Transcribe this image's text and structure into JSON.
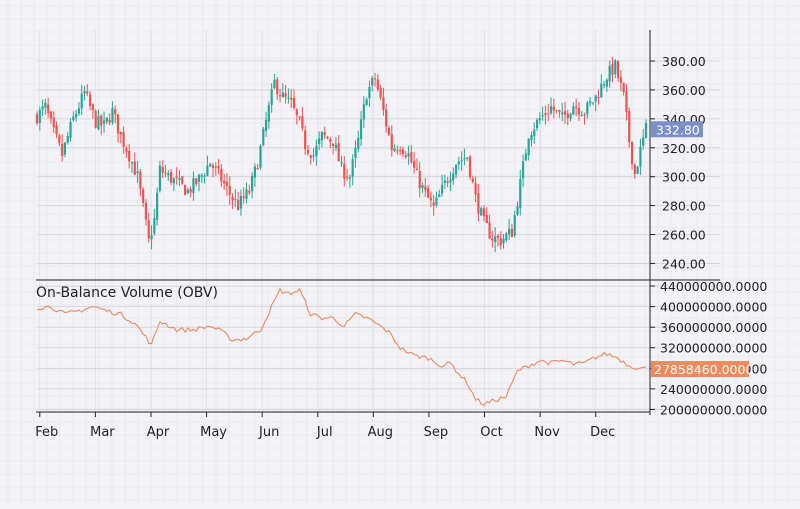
{
  "chart_data": [
    {
      "type": "candlestick",
      "title": "",
      "y_axis_side": "right",
      "ylim": [
        232,
        398
      ],
      "y_ticks": [
        "240.00",
        "260.00",
        "280.00",
        "300.00",
        "320.00",
        "340.00",
        "360.00",
        "380.00"
      ],
      "last_price_label": "332.80",
      "last_price": 332.8,
      "x_ticks": [
        "Feb",
        "Mar",
        "Apr",
        "May",
        "Jun",
        "Jul",
        "Aug",
        "Sep",
        "Oct",
        "Nov",
        "Dec"
      ],
      "grid": true,
      "colors": {
        "up": "#26a69a",
        "down": "#ef5350",
        "price_badge": "#7b8ec8"
      },
      "anchor_closes": [
        {
          "t": 0,
          "c": 342
        },
        {
          "t": 3,
          "c": 348
        },
        {
          "t": 6,
          "c": 330
        },
        {
          "t": 9,
          "c": 315
        },
        {
          "t": 13,
          "c": 340
        },
        {
          "t": 17,
          "c": 358
        },
        {
          "t": 21,
          "c": 338
        },
        {
          "t": 24,
          "c": 335
        },
        {
          "t": 27,
          "c": 345
        },
        {
          "t": 30,
          "c": 328
        },
        {
          "t": 33,
          "c": 315
        },
        {
          "t": 36,
          "c": 300
        },
        {
          "t": 38,
          "c": 278
        },
        {
          "t": 40,
          "c": 255
        },
        {
          "t": 42,
          "c": 270
        },
        {
          "t": 44,
          "c": 305
        },
        {
          "t": 47,
          "c": 300
        },
        {
          "t": 50,
          "c": 296
        },
        {
          "t": 54,
          "c": 290
        },
        {
          "t": 58,
          "c": 298
        },
        {
          "t": 62,
          "c": 310
        },
        {
          "t": 66,
          "c": 298
        },
        {
          "t": 69,
          "c": 288
        },
        {
          "t": 72,
          "c": 280
        },
        {
          "t": 76,
          "c": 290
        },
        {
          "t": 79,
          "c": 310
        },
        {
          "t": 82,
          "c": 338
        },
        {
          "t": 85,
          "c": 365
        },
        {
          "t": 88,
          "c": 355
        },
        {
          "t": 91,
          "c": 350
        },
        {
          "t": 94,
          "c": 336
        },
        {
          "t": 96,
          "c": 322
        },
        {
          "t": 99,
          "c": 315
        },
        {
          "t": 102,
          "c": 328
        },
        {
          "t": 106,
          "c": 325
        },
        {
          "t": 109,
          "c": 305
        },
        {
          "t": 112,
          "c": 300
        },
        {
          "t": 115,
          "c": 325
        },
        {
          "t": 118,
          "c": 358
        },
        {
          "t": 121,
          "c": 368
        },
        {
          "t": 124,
          "c": 345
        },
        {
          "t": 127,
          "c": 320
        },
        {
          "t": 130,
          "c": 322
        },
        {
          "t": 133,
          "c": 315
        },
        {
          "t": 136,
          "c": 300
        },
        {
          "t": 139,
          "c": 288
        },
        {
          "t": 142,
          "c": 278
        },
        {
          "t": 146,
          "c": 295
        },
        {
          "t": 150,
          "c": 310
        },
        {
          "t": 154,
          "c": 314
        },
        {
          "t": 157,
          "c": 285
        },
        {
          "t": 160,
          "c": 268
        },
        {
          "t": 163,
          "c": 258
        },
        {
          "t": 166,
          "c": 256
        },
        {
          "t": 170,
          "c": 262
        },
        {
          "t": 173,
          "c": 295
        },
        {
          "t": 176,
          "c": 330
        },
        {
          "t": 180,
          "c": 340
        },
        {
          "t": 184,
          "c": 348
        },
        {
          "t": 188,
          "c": 340
        },
        {
          "t": 192,
          "c": 350
        },
        {
          "t": 196,
          "c": 345
        },
        {
          "t": 200,
          "c": 355
        },
        {
          "t": 204,
          "c": 370
        },
        {
          "t": 207,
          "c": 376
        },
        {
          "t": 210,
          "c": 355
        },
        {
          "t": 212,
          "c": 325
        },
        {
          "t": 214,
          "c": 302
        },
        {
          "t": 216,
          "c": 318
        },
        {
          "t": 218,
          "c": 333
        }
      ]
    },
    {
      "type": "line",
      "title": "On-Balance Volume (OBV)",
      "y_axis_side": "right",
      "ylim": [
        195000000,
        444000000
      ],
      "y_ticks": [
        "200000000.0000",
        "240000000.0000",
        "280000000.0000",
        "320000000.0000",
        "360000000.0000",
        "400000000.0000",
        "440000000.0000"
      ],
      "last_value_label": "27858460.0000",
      "last_value": 278584600,
      "x_ticks": [
        "Feb",
        "Mar",
        "Apr",
        "May",
        "Jun",
        "Jul",
        "Aug",
        "Sep",
        "Oct",
        "Nov",
        "Dec"
      ],
      "grid": true,
      "colors": {
        "line": "#f08a5d",
        "value_badge": "#f08a5d"
      },
      "anchor_values": [
        {
          "t": 0,
          "v": 398000000
        },
        {
          "t": 5,
          "v": 400000000
        },
        {
          "t": 10,
          "v": 385000000
        },
        {
          "t": 15,
          "v": 392000000
        },
        {
          "t": 20,
          "v": 400000000
        },
        {
          "t": 25,
          "v": 392000000
        },
        {
          "t": 30,
          "v": 385000000
        },
        {
          "t": 35,
          "v": 368000000
        },
        {
          "t": 39,
          "v": 340000000
        },
        {
          "t": 41,
          "v": 325000000
        },
        {
          "t": 44,
          "v": 372000000
        },
        {
          "t": 50,
          "v": 355000000
        },
        {
          "t": 56,
          "v": 355000000
        },
        {
          "t": 62,
          "v": 362000000
        },
        {
          "t": 66,
          "v": 352000000
        },
        {
          "t": 70,
          "v": 335000000
        },
        {
          "t": 75,
          "v": 338000000
        },
        {
          "t": 80,
          "v": 355000000
        },
        {
          "t": 84,
          "v": 400000000
        },
        {
          "t": 87,
          "v": 432000000
        },
        {
          "t": 90,
          "v": 425000000
        },
        {
          "t": 94,
          "v": 432000000
        },
        {
          "t": 98,
          "v": 385000000
        },
        {
          "t": 102,
          "v": 378000000
        },
        {
          "t": 106,
          "v": 378000000
        },
        {
          "t": 110,
          "v": 362000000
        },
        {
          "t": 114,
          "v": 385000000
        },
        {
          "t": 118,
          "v": 378000000
        },
        {
          "t": 122,
          "v": 365000000
        },
        {
          "t": 126,
          "v": 350000000
        },
        {
          "t": 130,
          "v": 320000000
        },
        {
          "t": 135,
          "v": 305000000
        },
        {
          "t": 140,
          "v": 300000000
        },
        {
          "t": 145,
          "v": 285000000
        },
        {
          "t": 148,
          "v": 290000000
        },
        {
          "t": 151,
          "v": 270000000
        },
        {
          "t": 154,
          "v": 252000000
        },
        {
          "t": 157,
          "v": 220000000
        },
        {
          "t": 160,
          "v": 210000000
        },
        {
          "t": 164,
          "v": 218000000
        },
        {
          "t": 168,
          "v": 225000000
        },
        {
          "t": 172,
          "v": 275000000
        },
        {
          "t": 176,
          "v": 285000000
        },
        {
          "t": 180,
          "v": 295000000
        },
        {
          "t": 184,
          "v": 290000000
        },
        {
          "t": 188,
          "v": 295000000
        },
        {
          "t": 192,
          "v": 288000000
        },
        {
          "t": 196,
          "v": 290000000
        },
        {
          "t": 200,
          "v": 302000000
        },
        {
          "t": 204,
          "v": 308000000
        },
        {
          "t": 208,
          "v": 300000000
        },
        {
          "t": 212,
          "v": 285000000
        },
        {
          "t": 216,
          "v": 280000000
        },
        {
          "t": 218,
          "v": 280000000
        }
      ]
    }
  ]
}
